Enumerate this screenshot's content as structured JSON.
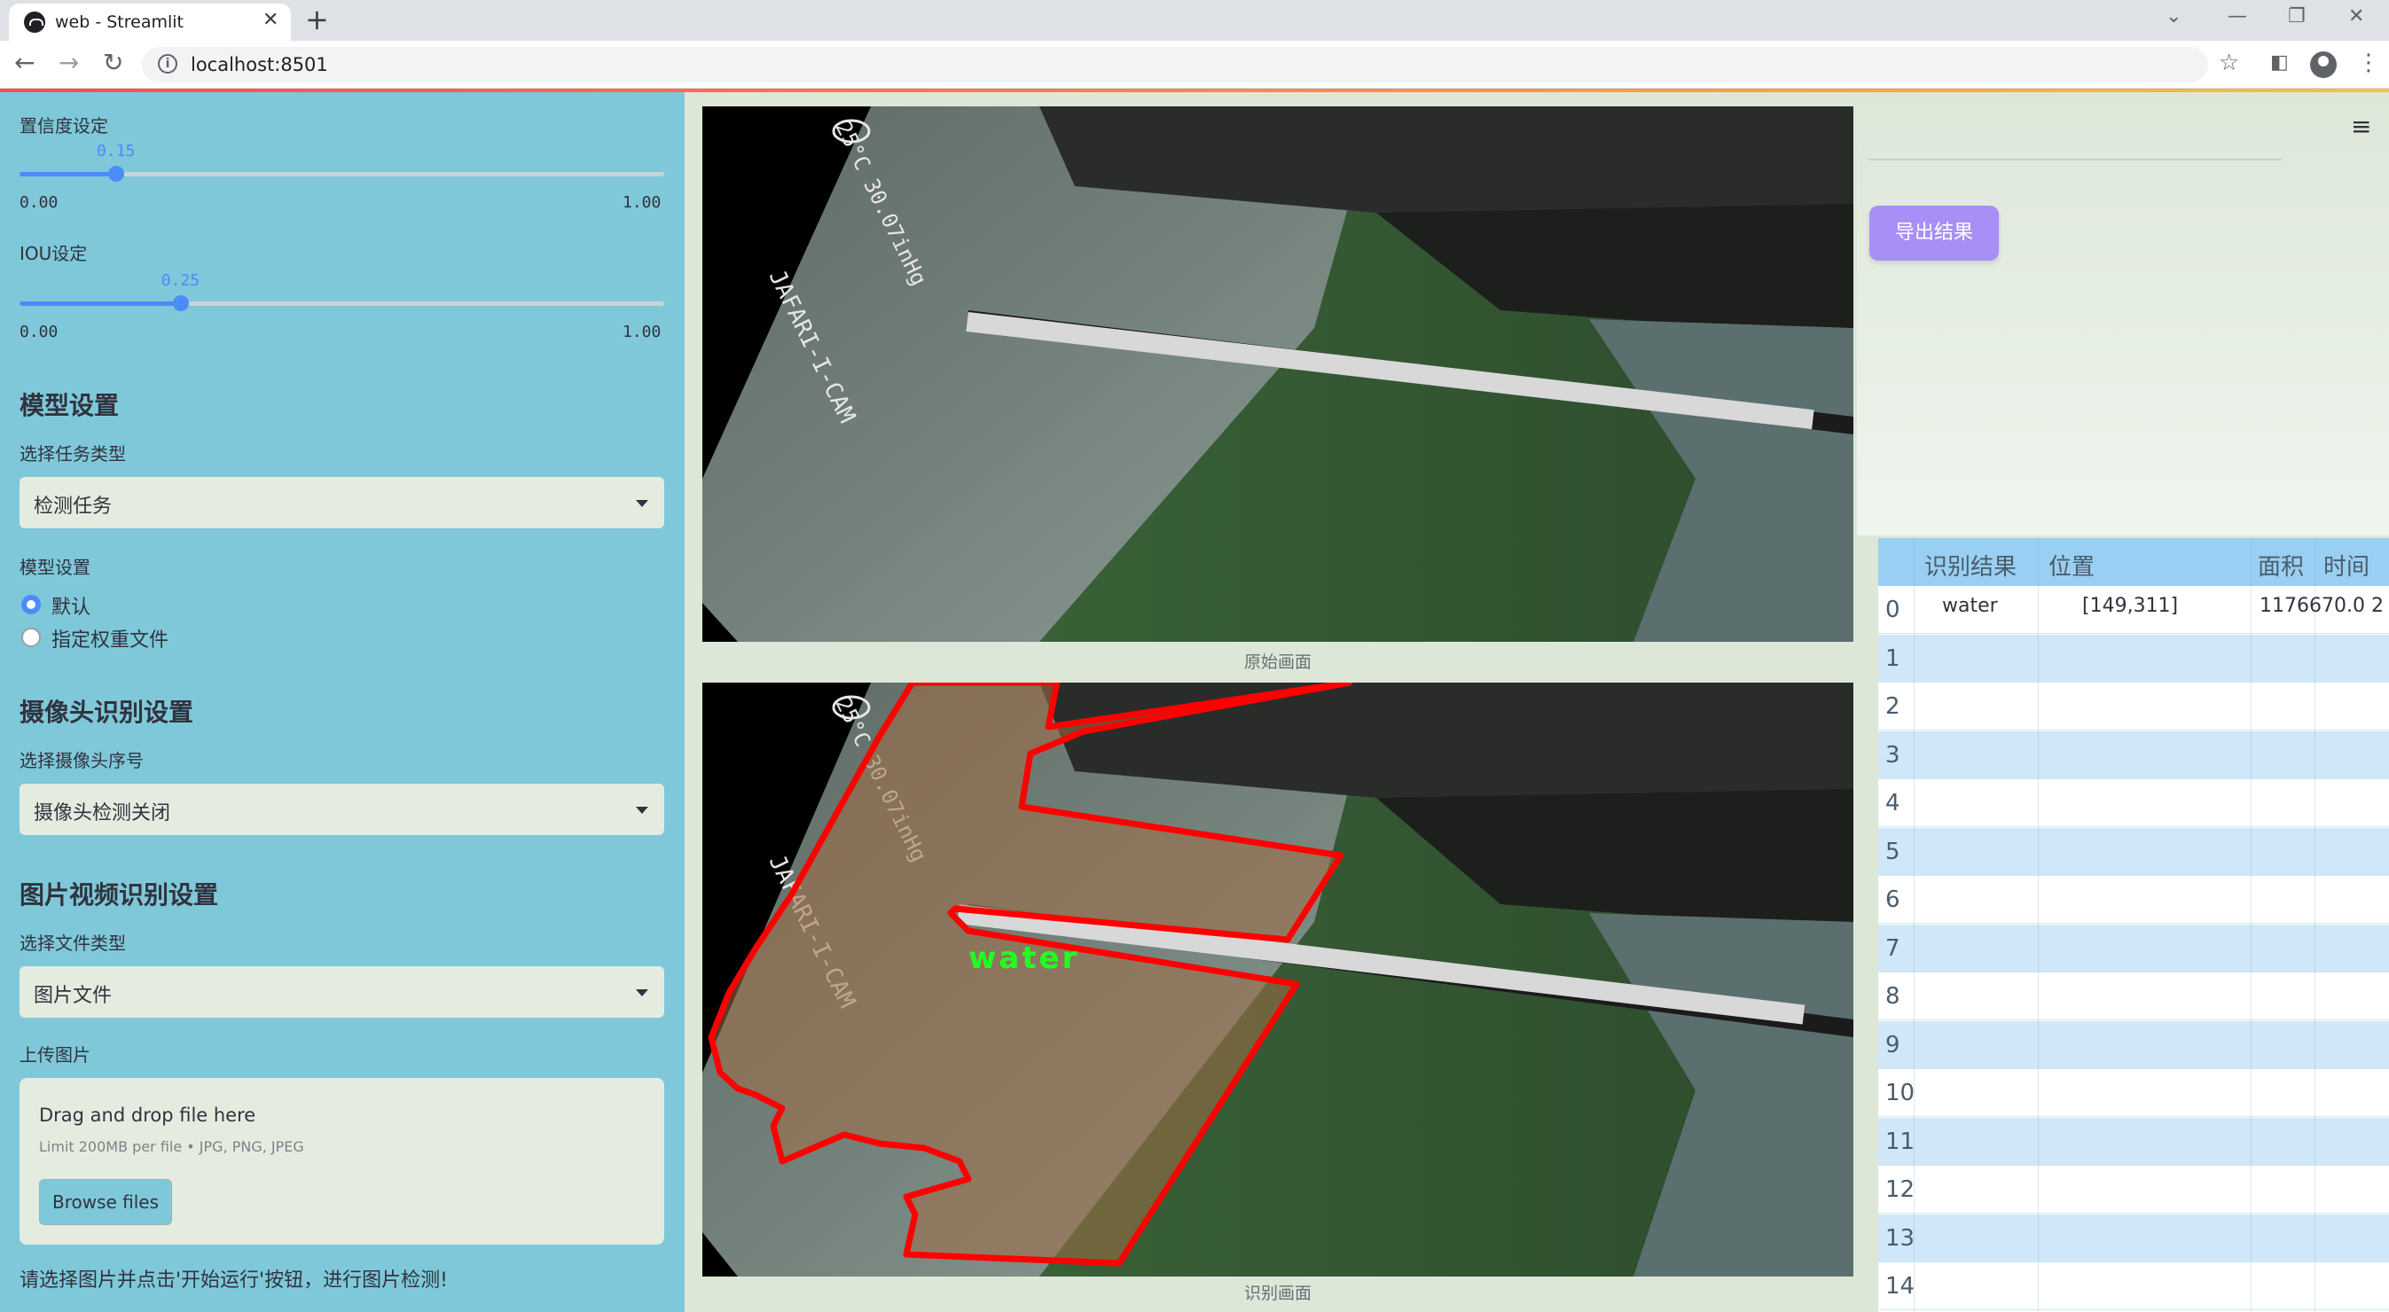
{
  "browser": {
    "tab_title": "web - Streamlit",
    "url": "localhost:8501",
    "close_glyph": "✕",
    "new_tab_glyph": "+"
  },
  "sidebar": {
    "confidence": {
      "label": "置信度设定",
      "value": "0.15",
      "fraction": 0.15,
      "min": "0.00",
      "max": "1.00"
    },
    "iou": {
      "label": "IOU设定",
      "value": "0.25",
      "fraction": 0.25,
      "min": "0.00",
      "max": "1.00"
    },
    "model_section": {
      "heading": "模型设置",
      "task_label": "选择任务类型",
      "task_value": "检测任务",
      "model_label": "模型设置",
      "options": [
        {
          "label": "默认",
          "checked": true
        },
        {
          "label": "指定权重文件",
          "checked": false
        }
      ]
    },
    "camera_section": {
      "heading": "摄像头识别设置",
      "camera_label": "选择摄像头序号",
      "camera_value": "摄像头检测关闭"
    },
    "media_section": {
      "heading": "图片视频识别设置",
      "file_type_label": "选择文件类型",
      "file_type_value": "图片文件",
      "upload_label": "上传图片",
      "drop_title": "Drag and drop file here",
      "drop_limit": "Limit 200MB per file • JPG, PNG, JPEG",
      "browse_label": "Browse files"
    },
    "footer_text": "请选择图片并点击'开始运行'按钮，进行图片检测!"
  },
  "main": {
    "original_caption": "原始画面",
    "result_caption": "识别画面",
    "export_label": "导出结果",
    "image_overlay": {
      "stamp": "25°C 30.07inHg",
      "camera": "JAFARI-I-CAM",
      "detection_label": "water"
    },
    "table": {
      "headers": [
        "识别结果",
        "位置",
        "面积",
        "时间"
      ],
      "rows": [
        {
          "index": "0",
          "result": "water",
          "position": "[149,311]",
          "area": "1176670.0",
          "time": "2"
        },
        {
          "index": "1"
        },
        {
          "index": "2"
        },
        {
          "index": "3"
        },
        {
          "index": "4"
        },
        {
          "index": "5"
        },
        {
          "index": "6"
        },
        {
          "index": "7"
        },
        {
          "index": "8"
        },
        {
          "index": "9"
        },
        {
          "index": "10"
        },
        {
          "index": "11"
        },
        {
          "index": "12"
        },
        {
          "index": "13"
        },
        {
          "index": "14"
        }
      ]
    }
  },
  "colors": {
    "sidebar_bg": "#7ec8d9",
    "main_bg": "#dde7d8",
    "accent_blue": "#4a8df8",
    "export_button": "#a88ff5",
    "detection_outline": "#ff0000",
    "detection_label": "#22ff22",
    "table_header": "#99cff2"
  },
  "icons": [
    "streamlit-favicon",
    "back-arrow-icon",
    "forward-arrow-icon",
    "reload-icon",
    "info-icon",
    "star-icon",
    "side-panel-icon",
    "profile-icon",
    "menu-dots-icon",
    "hamburger-menu-icon",
    "dropdown-arrow-icon"
  ]
}
